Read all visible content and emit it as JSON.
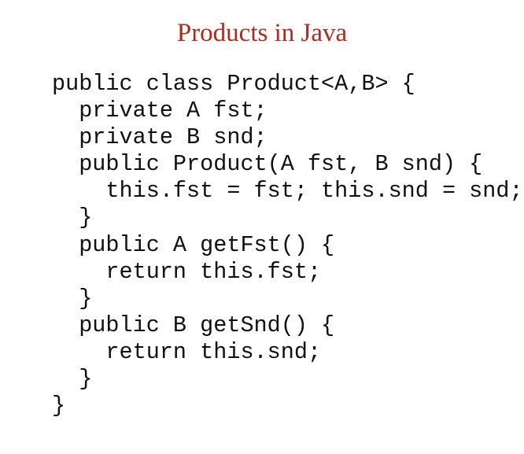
{
  "slide": {
    "title": "Products in Java",
    "code_lines": [
      "public class Product<A,B> {",
      "  private A fst;",
      "  private B snd;",
      "  public Product(A fst, B snd) {",
      "    this.fst = fst; this.snd = snd;",
      "  }",
      "  public A getFst() {",
      "    return this.fst;",
      "  }",
      "  public B getSnd() {",
      "    return this.snd;",
      "  }",
      "}"
    ]
  },
  "colors": {
    "title": "#b22a1e",
    "code_text": "#111111",
    "background": "#ffffff"
  }
}
